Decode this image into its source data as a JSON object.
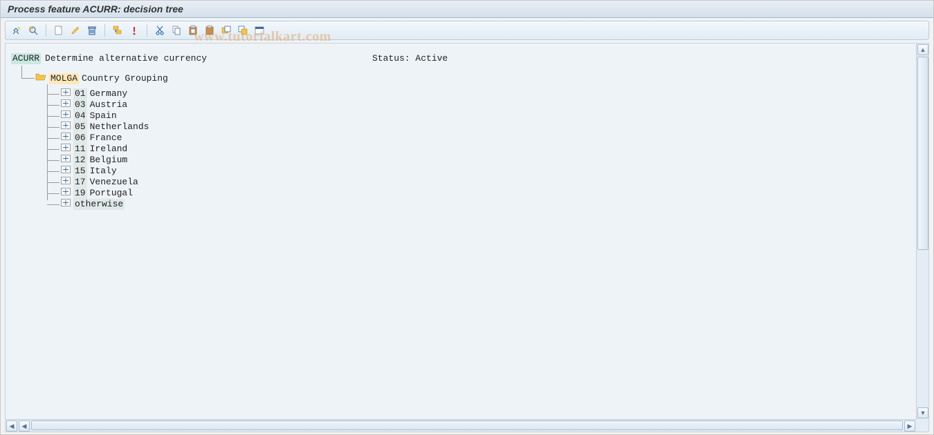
{
  "title": "Process feature ACURR: decision tree",
  "watermark": "www.tutorialkart.com",
  "toolbar": {
    "icons": [
      "change-display-icon",
      "find-icon",
      "SEP",
      "create-icon",
      "change-icon",
      "delete-icon",
      "SEP",
      "expand-subtree-icon",
      "collapse-icon",
      "SEP",
      "cut-icon",
      "copy-icon",
      "paste-icon",
      "clipboard-icon",
      "copy-block-icon",
      "paste-block-icon",
      "view-icon"
    ]
  },
  "tree": {
    "feature_code": "ACURR",
    "feature_desc": "Determine alternative currency",
    "status_label": "Status:",
    "status_value": "Active",
    "grouping_code": "MOLGA",
    "grouping_desc": "Country Grouping",
    "leaves": [
      {
        "code": "01",
        "label": "Germany"
      },
      {
        "code": "03",
        "label": "Austria"
      },
      {
        "code": "04",
        "label": "Spain"
      },
      {
        "code": "05",
        "label": "Netherlands"
      },
      {
        "code": "06",
        "label": "France"
      },
      {
        "code": "11",
        "label": "Ireland"
      },
      {
        "code": "12",
        "label": "Belgium"
      },
      {
        "code": "15",
        "label": "Italy"
      },
      {
        "code": "17",
        "label": "Venezuela"
      },
      {
        "code": "19",
        "label": "Portugal"
      },
      {
        "code": "otherwise",
        "label": ""
      }
    ]
  }
}
